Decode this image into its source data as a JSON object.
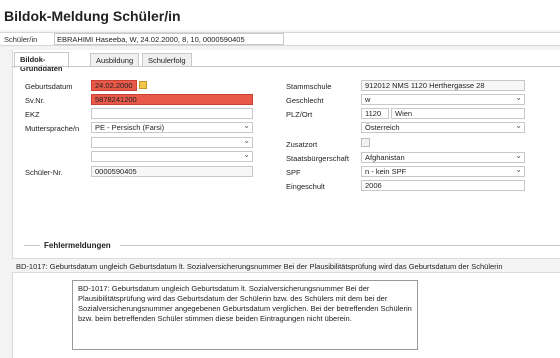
{
  "page": {
    "title": "Bildok-Meldung Schüler/in"
  },
  "student": {
    "label": "Schüler/in",
    "value": "EBRAHIMI Haseeba, W, 24.02.2000, 8, 10, 0000590405"
  },
  "tabs": [
    {
      "label": "Bildok-Grunddaten",
      "active": true
    },
    {
      "label": "Ausbildung",
      "active": false
    },
    {
      "label": "Schulerfolg",
      "active": false
    }
  ],
  "left": {
    "geburtsdatum": {
      "label": "Geburtsdatum",
      "value": "24.02.2000"
    },
    "svnr": {
      "label": "Sv.Nr.",
      "value": "5878241200"
    },
    "ekz": {
      "label": "EKZ",
      "value": ""
    },
    "muttersprache": {
      "label": "Muttersprache/n",
      "value": "PE - Persisch (Farsi)"
    },
    "extra1": {
      "value": ""
    },
    "extra2": {
      "value": ""
    },
    "schuelernr": {
      "label": "Schüler-Nr.",
      "value": "0000590405"
    }
  },
  "right": {
    "stammschule": {
      "label": "Stammschule",
      "value": "912012 NMS 1120 Herthergasse 28"
    },
    "geschlecht": {
      "label": "Geschlecht",
      "value": "w"
    },
    "plzort": {
      "label": "PLZ/Ort",
      "plz": "1120",
      "ort": "Wien"
    },
    "land": {
      "value": "Österreich"
    },
    "zusatzort": {
      "label": "Zusatzort"
    },
    "staatsbuergerschaft": {
      "label": "Staatsbürgerschaft",
      "value": "Afghanistan"
    },
    "spf": {
      "label": "SPF",
      "value": "n - kein SPF"
    },
    "eingeschult": {
      "label": "Eingeschult",
      "value": "2006"
    }
  },
  "errors": {
    "title": "Fehlermeldungen",
    "row": "BD-1017: Geburtsdatum ungleich Geburtsdatum lt. Sozialversicherungsnummer Bei der Plausibilitätsprüfung wird das Geburtsdatum der Schülerin",
    "tooltip": "BD-1017: Geburtsdatum ungleich Geburtsdatum lt. Sozialversicherungsnummer Bei der Plausibilitätsprüfung wird das Geburtsdatum der Schülerin bzw. des Schülers mit dem bei der Sozialversicherungsnummer angegebenen Geburtsdatum verglichen. Bei der betreffenden Schülerin bzw. beim betreffenden Schüler stimmen diese beiden Eintragungen nicht überein."
  },
  "colors": {
    "error_field": "#e8594a",
    "calendar": "#f3c64a"
  }
}
